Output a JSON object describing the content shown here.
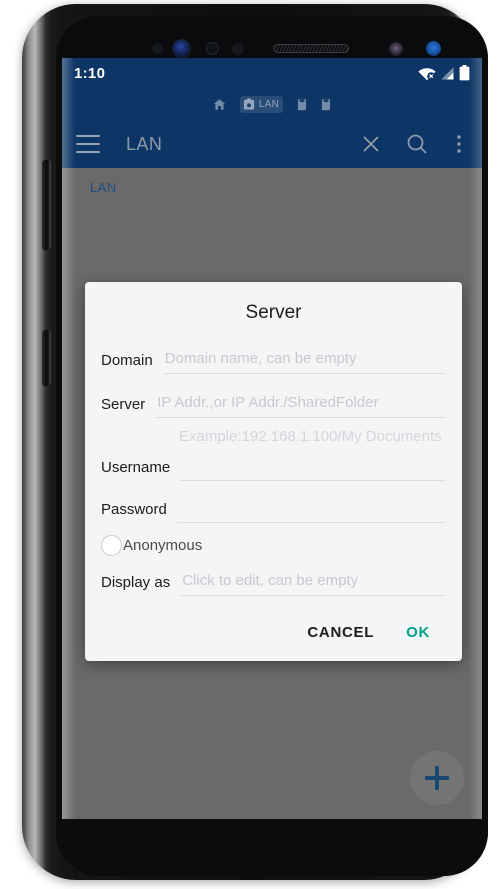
{
  "status_bar": {
    "time": "1:10",
    "icons": [
      "wifi-off-icon",
      "signal-icon",
      "battery-icon"
    ]
  },
  "toolbar": {
    "title": "LAN",
    "menu_icon": "hamburger-menu-icon",
    "close_icon": "close-icon",
    "search_icon": "search-icon",
    "overflow_icon": "overflow-menu-icon",
    "tabs": [
      {
        "label": "",
        "icon": "home-icon",
        "active": false
      },
      {
        "label": "LAN",
        "icon": "folder-lock-icon",
        "active": true
      },
      {
        "label": "",
        "icon": "storage-icon",
        "active": false
      },
      {
        "label": "",
        "icon": "storage-icon",
        "active": false
      }
    ]
  },
  "content": {
    "breadcrumb": "LAN",
    "fab_icon": "plus-icon"
  },
  "dialog": {
    "title": "Server",
    "fields": [
      {
        "label": "Domain",
        "value": "",
        "placeholder": "Domain name, can be empty"
      },
      {
        "label": "Server",
        "value": "",
        "placeholder": "IP Addr.,or IP Addr./SharedFolder"
      },
      {
        "label": "Username",
        "value": "",
        "placeholder": ""
      },
      {
        "label": "Password",
        "value": "",
        "placeholder": ""
      },
      {
        "label": "Display as",
        "value": "",
        "placeholder": "Click to edit, can be empty"
      }
    ],
    "server_hint": "Example:192.168.1.100/My Documents",
    "anonymous": {
      "label": "Anonymous",
      "checked": false
    },
    "cancel_label": "CANCEL",
    "ok_label": "OK"
  },
  "colors": {
    "toolbar_blue": "#0d3566",
    "ok_teal": "#00a08a",
    "dialog_bg": "#f4f5f7",
    "scrim_gray": "#6a6a6a",
    "fab_plus": "#18486f",
    "breadcrumb_blue": "#1d4d80"
  }
}
